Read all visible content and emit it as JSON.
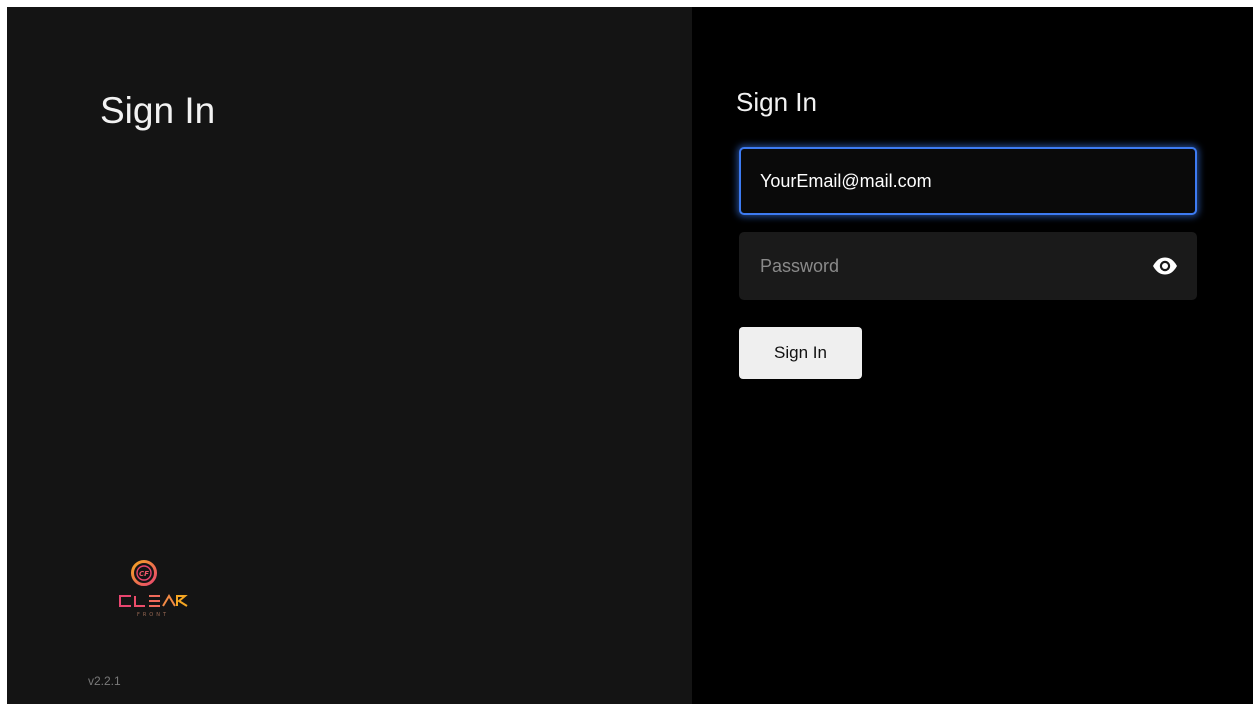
{
  "left_panel": {
    "title": "Sign In",
    "logo": {
      "monogram": "CF",
      "word": "CLEAR",
      "sub": "FRONT",
      "icon": "clear-front-logo",
      "colors": {
        "circle": "#f0566a",
        "word_left": "#e8456f",
        "word_right": "#f5a623"
      }
    },
    "version": "v2.2.1"
  },
  "form": {
    "title": "Sign In",
    "email": {
      "value": "YourEmail@mail.com",
      "focused": true
    },
    "password": {
      "placeholder": "Password",
      "toggle_icon": "eye-icon"
    },
    "submit_label": "Sign In"
  },
  "colors": {
    "left_background": "#141414",
    "right_background": "#000000",
    "focus_ring": "#3d7bf2",
    "input_background": "#1a1a1a",
    "button_background": "#efefef"
  }
}
